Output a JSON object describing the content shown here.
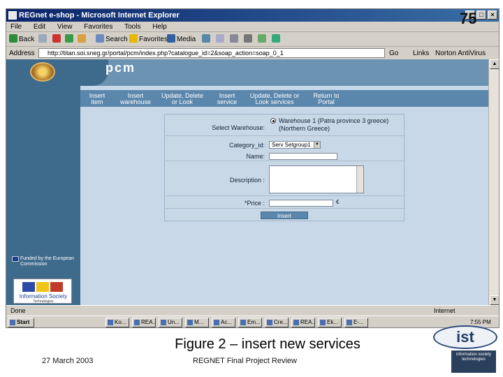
{
  "window": {
    "title": "REGnet e-shop - Microsoft Internet Explorer",
    "controls": [
      "_",
      "□",
      "×"
    ]
  },
  "menu": [
    "File",
    "Edit",
    "View",
    "Favorites",
    "Tools",
    "Help"
  ],
  "toolbar": {
    "back": "Back",
    "search": "Search",
    "favorites": "Favorites",
    "media": "Media"
  },
  "address": {
    "label": "Address",
    "url": "http://titan.soi.sneg.gr/portal/pcm/index.php?catalogue_id=2&soap_action=soap_0_1",
    "go": "Go",
    "links": "Links",
    "norton": "Norton AntiVirus"
  },
  "site": {
    "brand": "pcm",
    "eu": "Funded by the European Commission",
    "ist_title": "Information Society",
    "ist_sub": "Technologies"
  },
  "nav": [
    {
      "l1": "Insert",
      "l2": "item"
    },
    {
      "l1": "Insert",
      "l2": "warehouse"
    },
    {
      "l1": "Update, Delete",
      "l2": "or Look"
    },
    {
      "l1": "Insert",
      "l2": "service"
    },
    {
      "l1": "Update, Delete or",
      "l2": "Look services"
    },
    {
      "l1": "Return to",
      "l2": "Portal"
    }
  ],
  "form": {
    "warehouse_label": "Select Warehouse:",
    "warehouse_option": "Warehouse 1 (Patra province 3 greece) (Northern Greece)",
    "category_label": "Category_id:",
    "category_value": "Serv Setgroup1",
    "name_label": "Name:",
    "description_label": "Description :",
    "price_label": "*Price :",
    "price_suffix": "€",
    "insert_button": "Insert"
  },
  "status": {
    "left": "Done",
    "right": "Internet"
  },
  "taskbar": {
    "start": "Start",
    "clock": "7:55 PM",
    "items": [
      "Ko...",
      "REA...",
      "Un...",
      "M...",
      "Ac...",
      "Em...",
      "Cre...",
      "REA...",
      "Ek...",
      "E-..."
    ]
  },
  "slide": {
    "number": "75",
    "caption": "Figure 2 – insert new services",
    "date": "27 March 2003",
    "footer": "REGNET Final Project Review",
    "ist_logo": "ist",
    "ist_box": "information society technologies"
  }
}
